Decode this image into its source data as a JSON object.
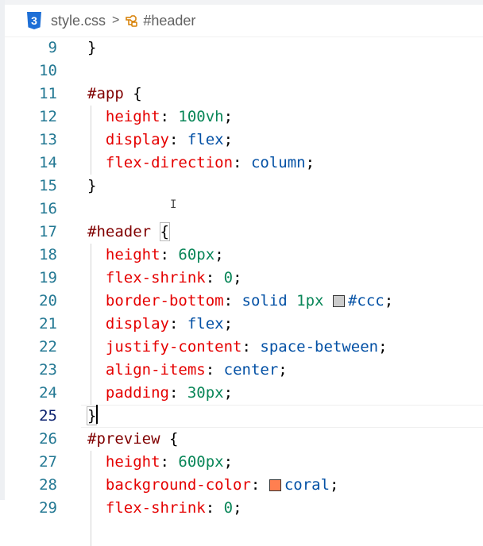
{
  "breadcrumb": {
    "file_icon_label": "3",
    "file_name": "style.css",
    "separator": ">",
    "symbol_icon": "symbol-class-icon",
    "symbol_name": "#header"
  },
  "colors": {
    "selector": "#800000",
    "property": "#e50000",
    "number": "#098658",
    "value": "#0451a5",
    "line_number": "#237893",
    "swatch_ccc": "#cccccc",
    "swatch_coral": "#ff7f50"
  },
  "editor": {
    "current_line": "25",
    "lines": [
      {
        "num": "9",
        "t": [
          {
            "c": "pun",
            "v": "}"
          }
        ]
      },
      {
        "num": "10",
        "t": []
      },
      {
        "num": "11",
        "t": [
          {
            "c": "sel",
            "v": "#app"
          },
          {
            "c": "pun",
            "v": " {"
          }
        ]
      },
      {
        "num": "12",
        "t": [
          {
            "c": "pun",
            "v": "  "
          },
          {
            "c": "prop",
            "v": "height"
          },
          {
            "c": "pun",
            "v": ": "
          },
          {
            "c": "num",
            "v": "100vh"
          },
          {
            "c": "pun",
            "v": ";"
          }
        ]
      },
      {
        "num": "13",
        "t": [
          {
            "c": "pun",
            "v": "  "
          },
          {
            "c": "prop",
            "v": "display"
          },
          {
            "c": "pun",
            "v": ": "
          },
          {
            "c": "val",
            "v": "flex"
          },
          {
            "c": "pun",
            "v": ";"
          }
        ]
      },
      {
        "num": "14",
        "t": [
          {
            "c": "pun",
            "v": "  "
          },
          {
            "c": "prop",
            "v": "flex-direction"
          },
          {
            "c": "pun",
            "v": ": "
          },
          {
            "c": "val",
            "v": "column"
          },
          {
            "c": "pun",
            "v": ";"
          }
        ]
      },
      {
        "num": "15",
        "t": [
          {
            "c": "pun",
            "v": "}"
          }
        ]
      },
      {
        "num": "16",
        "t": []
      },
      {
        "num": "17",
        "t": [
          {
            "c": "sel",
            "v": "#header"
          },
          {
            "c": "pun",
            "v": " "
          },
          {
            "c": "pun",
            "v": "{",
            "box": true
          }
        ]
      },
      {
        "num": "18",
        "t": [
          {
            "c": "pun",
            "v": "  "
          },
          {
            "c": "prop",
            "v": "height"
          },
          {
            "c": "pun",
            "v": ": "
          },
          {
            "c": "num",
            "v": "60px"
          },
          {
            "c": "pun",
            "v": ";"
          }
        ]
      },
      {
        "num": "19",
        "t": [
          {
            "c": "pun",
            "v": "  "
          },
          {
            "c": "prop",
            "v": "flex-shrink"
          },
          {
            "c": "pun",
            "v": ": "
          },
          {
            "c": "num",
            "v": "0"
          },
          {
            "c": "pun",
            "v": ";"
          }
        ]
      },
      {
        "num": "20",
        "t": [
          {
            "c": "pun",
            "v": "  "
          },
          {
            "c": "prop",
            "v": "border-bottom"
          },
          {
            "c": "pun",
            "v": ": "
          },
          {
            "c": "val",
            "v": "solid"
          },
          {
            "c": "pun",
            "v": " "
          },
          {
            "c": "num",
            "v": "1px"
          },
          {
            "c": "pun",
            "v": " "
          },
          {
            "swatch": "#cccccc"
          },
          {
            "c": "val",
            "v": "#ccc"
          },
          {
            "c": "pun",
            "v": ";"
          }
        ]
      },
      {
        "num": "21",
        "t": [
          {
            "c": "pun",
            "v": "  "
          },
          {
            "c": "prop",
            "v": "display"
          },
          {
            "c": "pun",
            "v": ": "
          },
          {
            "c": "val",
            "v": "flex"
          },
          {
            "c": "pun",
            "v": ";"
          }
        ]
      },
      {
        "num": "22",
        "t": [
          {
            "c": "pun",
            "v": "  "
          },
          {
            "c": "prop",
            "v": "justify-content"
          },
          {
            "c": "pun",
            "v": ": "
          },
          {
            "c": "val",
            "v": "space-between"
          },
          {
            "c": "pun",
            "v": ";"
          }
        ]
      },
      {
        "num": "23",
        "t": [
          {
            "c": "pun",
            "v": "  "
          },
          {
            "c": "prop",
            "v": "align-items"
          },
          {
            "c": "pun",
            "v": ": "
          },
          {
            "c": "val",
            "v": "center"
          },
          {
            "c": "pun",
            "v": ";"
          }
        ]
      },
      {
        "num": "24",
        "t": [
          {
            "c": "pun",
            "v": "  "
          },
          {
            "c": "prop",
            "v": "padding"
          },
          {
            "c": "pun",
            "v": ": "
          },
          {
            "c": "num",
            "v": "30px"
          },
          {
            "c": "pun",
            "v": ";"
          }
        ]
      },
      {
        "num": "25",
        "t": [
          {
            "c": "pun",
            "v": "}",
            "box": true
          }
        ]
      },
      {
        "num": "26",
        "t": [
          {
            "c": "sel",
            "v": "#preview"
          },
          {
            "c": "pun",
            "v": " {"
          }
        ]
      },
      {
        "num": "27",
        "t": [
          {
            "c": "pun",
            "v": "  "
          },
          {
            "c": "prop",
            "v": "height"
          },
          {
            "c": "pun",
            "v": ": "
          },
          {
            "c": "num",
            "v": "600px"
          },
          {
            "c": "pun",
            "v": ";"
          }
        ]
      },
      {
        "num": "28",
        "t": [
          {
            "c": "pun",
            "v": "  "
          },
          {
            "c": "prop",
            "v": "background-color"
          },
          {
            "c": "pun",
            "v": ": "
          },
          {
            "swatch": "#ff7f50"
          },
          {
            "c": "val",
            "v": "coral"
          },
          {
            "c": "pun",
            "v": ";"
          }
        ]
      },
      {
        "num": "29",
        "t": [
          {
            "c": "pun",
            "v": "  "
          },
          {
            "c": "prop",
            "v": "flex-shrink"
          },
          {
            "c": "pun",
            "v": ": "
          },
          {
            "c": "num",
            "v": "0"
          },
          {
            "c": "pun",
            "v": ";"
          }
        ]
      }
    ]
  }
}
